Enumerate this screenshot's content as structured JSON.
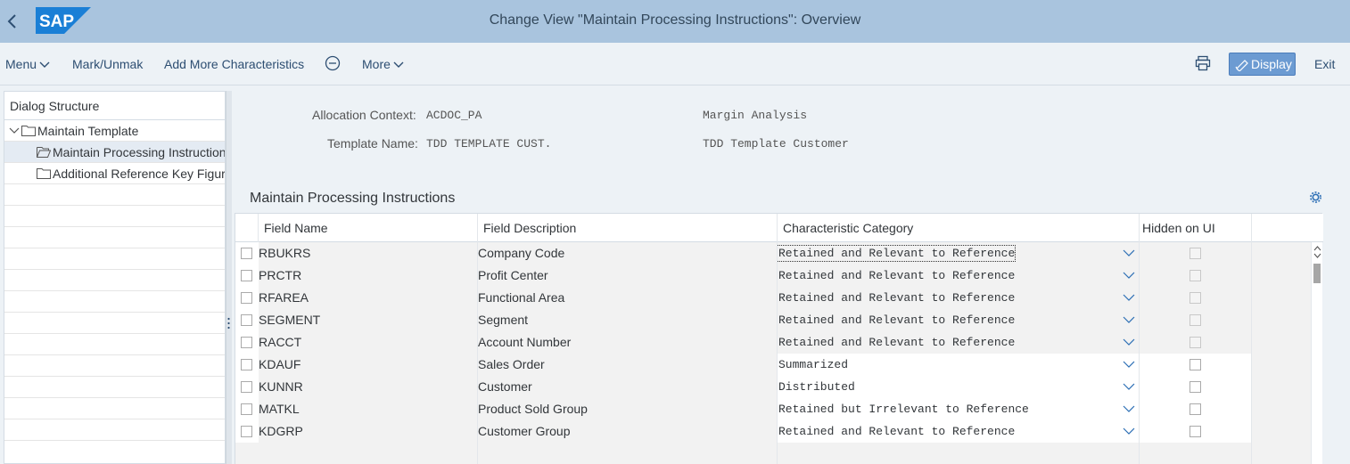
{
  "header": {
    "title": "Change View \"Maintain Processing Instructions\": Overview",
    "logo_text": "SAP"
  },
  "toolbar": {
    "menu": "Menu",
    "mark": "Mark/Unmak",
    "add_chars": "Add More Characteristics",
    "more": "More",
    "display": "Display",
    "exit": "Exit"
  },
  "dialog": {
    "title": "Dialog Structure",
    "items": [
      {
        "label": "Maintain Template",
        "level": 0,
        "expanded": true
      },
      {
        "label": "Maintain Processing Instructions",
        "level": 1,
        "selected": true
      },
      {
        "label": "Additional Reference Key Figures",
        "level": 1
      }
    ]
  },
  "context": {
    "alloc_label": "Allocation Context:",
    "alloc_value": "ACDOC_PA",
    "alloc_desc": "Margin Analysis",
    "template_label": "Template Name:",
    "template_value": "TDD TEMPLATE CUST.",
    "template_desc": "TDD Template Customer"
  },
  "section": {
    "title": "Maintain Processing Instructions"
  },
  "table": {
    "columns": [
      "Field Name",
      "Field Description",
      "Characteristic Category",
      "Hidden on UI"
    ],
    "rows": [
      {
        "name": "RBUKRS",
        "desc": "Company Code",
        "category": "Retained and Relevant to Reference",
        "editable": false
      },
      {
        "name": "PRCTR",
        "desc": "Profit Center",
        "category": "Retained and Relevant to Reference",
        "editable": false
      },
      {
        "name": "RFAREA",
        "desc": "Functional Area",
        "category": "Retained and Relevant to Reference",
        "editable": false
      },
      {
        "name": "SEGMENT",
        "desc": "Segment",
        "category": "Retained and Relevant to Reference",
        "editable": false
      },
      {
        "name": "RACCT",
        "desc": "Account Number",
        "category": "Retained and Relevant to Reference",
        "editable": false
      },
      {
        "name": "KDAUF",
        "desc": "Sales Order",
        "category": "Summarized",
        "editable": true
      },
      {
        "name": "KUNNR",
        "desc": "Customer",
        "category": "Distributed",
        "editable": true
      },
      {
        "name": "MATKL",
        "desc": "Product Sold Group",
        "category": "Retained but Irrelevant to Reference",
        "editable": true
      },
      {
        "name": "KDGRP",
        "desc": "Customer Group",
        "category": "Retained and Relevant to Reference",
        "editable": true
      }
    ]
  },
  "colors": {
    "shell": "#a9c4de",
    "accent": "#6c9bd2",
    "link": "#2d4e72"
  }
}
